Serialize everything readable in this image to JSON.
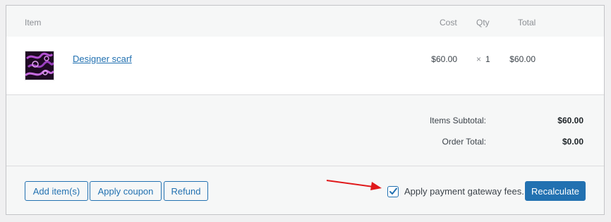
{
  "headers": {
    "item": "Item",
    "cost": "Cost",
    "qty": "Qty",
    "total": "Total"
  },
  "line_item": {
    "name": "Designer scarf",
    "cost": "$60.00",
    "qty_symbol": "×",
    "qty": "1",
    "total": "$60.00"
  },
  "totals": {
    "subtotal_label": "Items Subtotal:",
    "subtotal_value": "$60.00",
    "order_total_label": "Order Total:",
    "order_total_value": "$0.00"
  },
  "actions": {
    "add_items": "Add item(s)",
    "apply_coupon": "Apply coupon",
    "refund": "Refund",
    "gateway_fees_label": "Apply payment gateway fees.",
    "gateway_fees_checked": true,
    "recalculate": "Recalculate"
  },
  "colors": {
    "accent": "#2271b1",
    "arrow": "#e0191b"
  }
}
